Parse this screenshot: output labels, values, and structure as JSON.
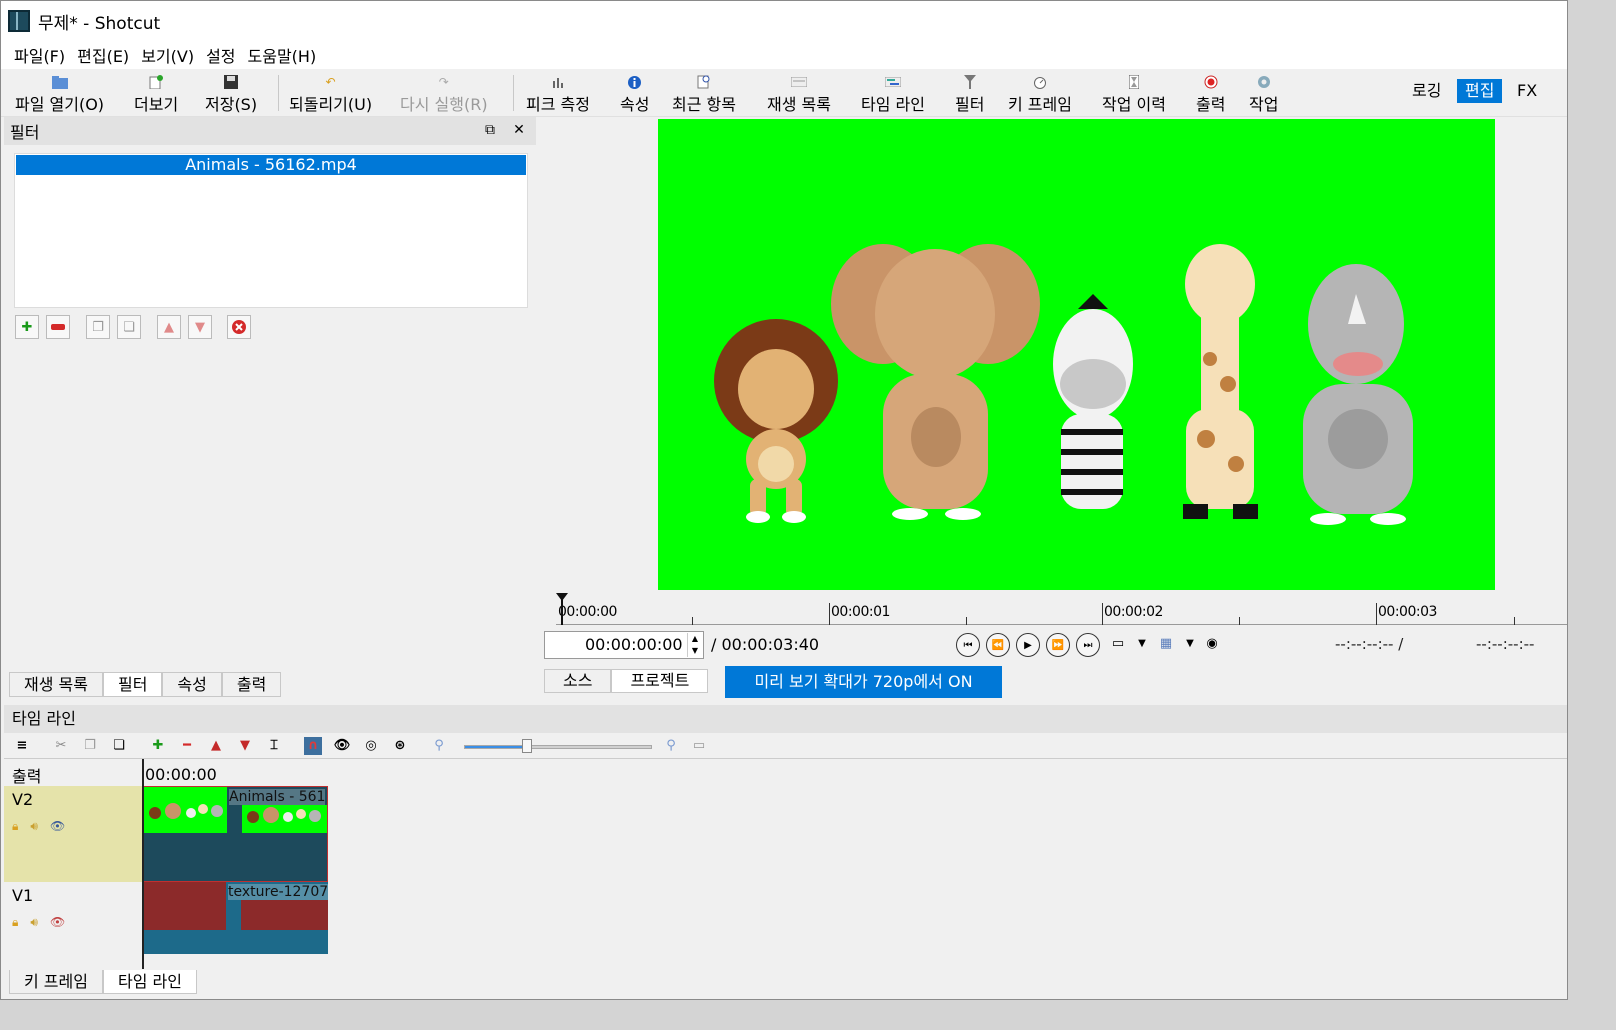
{
  "window": {
    "title": "무제* - Shotcut"
  },
  "menu": [
    "파일(F)",
    "편집(E)",
    "보기(V)",
    "설정",
    "도움말(H)"
  ],
  "toolbar": {
    "open": "파일 열기(O)",
    "more": "더보기",
    "save": "저장(S)",
    "undo": "되돌리기(U)",
    "redo": "다시 실행(R)",
    "peak": "피크 측정",
    "properties": "속성",
    "recent": "최근 항목",
    "playlist": "재생 목록",
    "timeline": "타임 라인",
    "filters": "필터",
    "keyframes": "키 프레임",
    "jobs": "작업 이력",
    "export": "출력",
    "work": "작업",
    "layouts": [
      "로깅",
      "편집",
      "FX"
    ],
    "active_layout": "편집"
  },
  "filters_panel": {
    "title": "필터",
    "selected_clip": "Animals - 56162.mp4"
  },
  "left_tabs": [
    "재생 목록",
    "필터",
    "속성",
    "출력"
  ],
  "player": {
    "ruler_labels": [
      "00:00:00",
      "00:00:01",
      "00:00:02",
      "00:00:03"
    ],
    "timecode": "00:00:00:00",
    "duration": "/ 00:00:03:40",
    "in_point": "--:--:--:-- /",
    "out_point": "--:--:--:--",
    "tabs": [
      "소스",
      "프로젝트"
    ],
    "zoom_banner": "미리 보기 확대가 720p에서 ON"
  },
  "timeline": {
    "title": "타임 라인",
    "ruler_start": "00:00:00",
    "output_label": "출력",
    "tracks": [
      {
        "name": "V2",
        "clip": "Animals - 561"
      },
      {
        "name": "V1",
        "clip": "texture-12707"
      }
    ],
    "zoom_level": 0.34
  },
  "bottom_tabs": [
    "키 프레임",
    "타임 라인"
  ],
  "colors": {
    "accent": "#0078d7",
    "green_screen": "#00ff00",
    "v2_track": "#e5e3aa",
    "texture": "#8c2a2a"
  }
}
